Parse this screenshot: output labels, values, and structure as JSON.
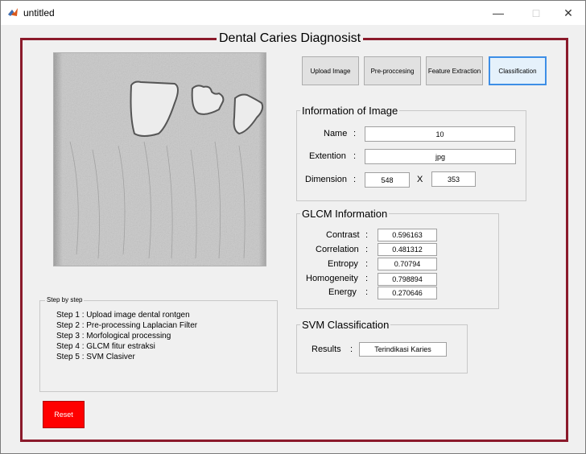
{
  "window": {
    "title": "untitled"
  },
  "main": {
    "title": "Dental Caries Diagnosist"
  },
  "toolbar": {
    "upload_label": "Upload Image",
    "preprocessing_label": "Pre-proccesing",
    "feature_label": "Feature Extraction",
    "classification_label": "Classification"
  },
  "info": {
    "title": "Information of Image",
    "name_label": "Name",
    "name_value": "10",
    "ext_label": "Extention",
    "ext_value": "jpg",
    "dim_label": "Dimension",
    "dim_width": "548",
    "dim_x": "X",
    "dim_height": "353",
    "colon": ":"
  },
  "glcm": {
    "title": "GLCM Information",
    "rows": [
      {
        "label": "Contrast",
        "value": "0.596163"
      },
      {
        "label": "Correlation",
        "value": "0.481312"
      },
      {
        "label": "Entropy",
        "value": "0.70794"
      },
      {
        "label": "Homogeneity",
        "value": "0.798894"
      },
      {
        "label": "Energy",
        "value": "0.270646"
      }
    ]
  },
  "svm": {
    "title": "SVM Classification",
    "results_label": "Results",
    "results_value": "Terindikasi Karies"
  },
  "steps": {
    "title": "Step by step",
    "items": [
      "Step 1 : Upload image dental rontgen",
      "Step 2 : Pre-processing Laplacian Filter",
      "Step 3 : Morfological processing",
      "Step 4 : GLCM fitur estraksi",
      "Step 5 : SVM Clasiver"
    ]
  },
  "reset_label": "Reset",
  "colors": {
    "frame": "#8b1a2b",
    "reset": "#ff0000",
    "active_border": "#3d8ee6"
  }
}
